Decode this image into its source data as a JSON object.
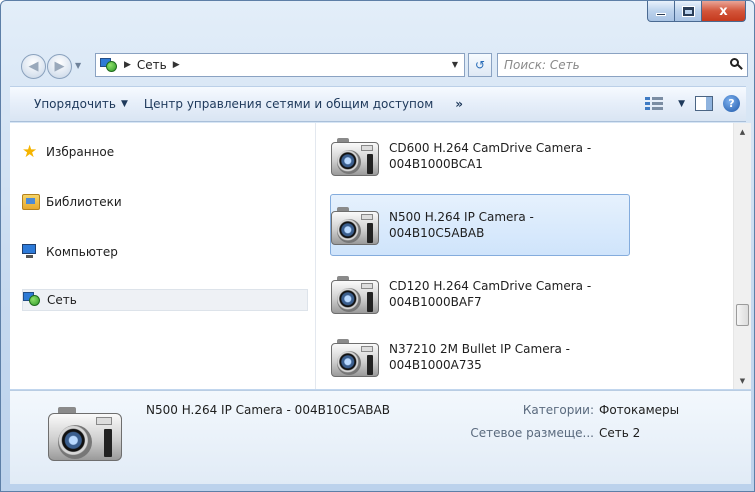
{
  "window": {
    "close_glyph": "x",
    "min_icon": "minimize-icon",
    "max_icon": "maximize-icon"
  },
  "address_bar": {
    "breadcrumb": [
      "Сеть"
    ],
    "search_placeholder": "Поиск: Сеть",
    "icons": {
      "back": "back-arrow-icon",
      "forward": "forward-arrow-icon",
      "refresh": "refresh-icon",
      "search": "search-icon"
    }
  },
  "toolbar": {
    "organize_label": "Упорядочить",
    "network_center_label": "Центр управления сетями и общим доступом",
    "more_label": "»"
  },
  "nav": {
    "items": [
      {
        "label": "Избранное",
        "icon": "star-icon"
      },
      {
        "label": "Библиотеки",
        "icon": "libraries-icon"
      },
      {
        "label": "Компьютер",
        "icon": "computer-icon"
      },
      {
        "label": "Сеть",
        "icon": "network-icon",
        "selected": true
      }
    ]
  },
  "content": {
    "items": [
      {
        "line1": "CD600 H.264 CamDrive Camera -",
        "line2": "004B1000BCA1",
        "selected": false
      },
      {
        "line1": "N500 H.264 IP Camera -",
        "line2": "004B10C5ABAB",
        "selected": true
      },
      {
        "line1": "CD120 H.264 CamDrive Camera -",
        "line2": "004B1000BAF7",
        "selected": false
      },
      {
        "line1": "N37210 2M Bullet IP Camera -",
        "line2": "004B1000A735",
        "selected": false
      }
    ]
  },
  "details": {
    "name": "N500 H.264 IP Camera - 004B10C5ABAB",
    "category_label": "Категории:",
    "category_value": "Фотокамеры",
    "location_label": "Сетевое размеще...",
    "location_value": "Сеть 2"
  },
  "scrollbar": {
    "thumb_position": 0.78
  }
}
